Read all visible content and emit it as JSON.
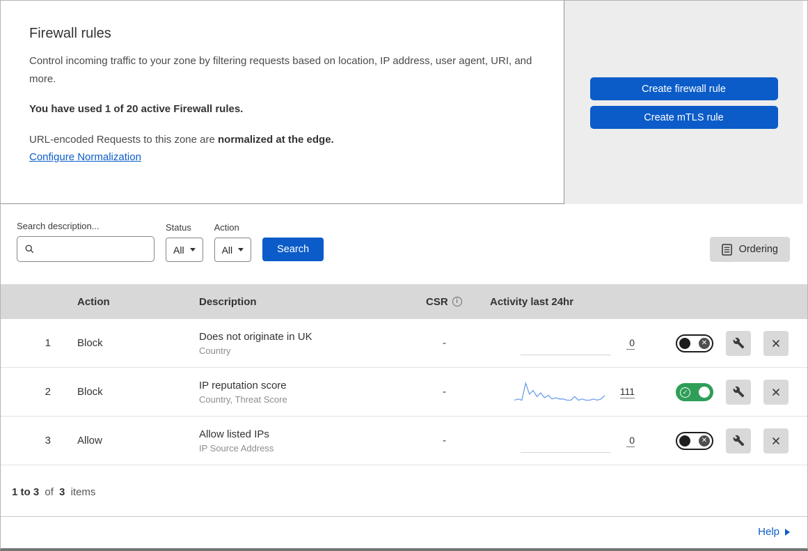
{
  "header": {
    "title": "Firewall rules",
    "description": "Control incoming traffic to your zone by filtering requests based on location, IP address, user agent, URI, and more.",
    "usage": "You have used 1 of 20 active Firewall rules.",
    "normalization_prefix": "URL-encoded Requests to this zone are",
    "normalization_bold": "normalized at the edge.",
    "configure_link": "Configure Normalization",
    "create_firewall_button": "Create firewall rule",
    "create_mtls_button": "Create mTLS rule"
  },
  "filters": {
    "search_label": "Search description...",
    "status_label": "Status",
    "status_value": "All",
    "action_label": "Action",
    "action_value": "All",
    "search_button": "Search",
    "ordering_button": "Ordering"
  },
  "table": {
    "columns": {
      "action": "Action",
      "description": "Description",
      "csr": "CSR",
      "activity": "Activity last 24hr"
    },
    "rows": [
      {
        "num": "1",
        "action": "Block",
        "title": "Does not originate in UK",
        "subtitle": "Country",
        "csr": "-",
        "count": "0",
        "enabled": false,
        "sparkline": []
      },
      {
        "num": "2",
        "action": "Block",
        "title": "IP reputation score",
        "subtitle": "Country, Threat Score",
        "csr": "-",
        "count": "111",
        "enabled": true,
        "sparkline": [
          2,
          3,
          2,
          16,
          7,
          10,
          5,
          8,
          4,
          6,
          3,
          4,
          3,
          3,
          2,
          2,
          5,
          2,
          3,
          2,
          2,
          3,
          2,
          3,
          6
        ]
      },
      {
        "num": "3",
        "action": "Allow",
        "title": "Allow listed IPs",
        "subtitle": "IP Source Address",
        "csr": "-",
        "count": "0",
        "enabled": false,
        "sparkline": []
      }
    ]
  },
  "footer": {
    "range": "1 to 3",
    "of": "of",
    "total": "3",
    "items": "items"
  },
  "help": {
    "label": "Help"
  },
  "colors": {
    "primary_blue": "#0b5cc9",
    "toggle_green": "#2e9e58",
    "sparkline_blue": "#6d9eeb"
  }
}
